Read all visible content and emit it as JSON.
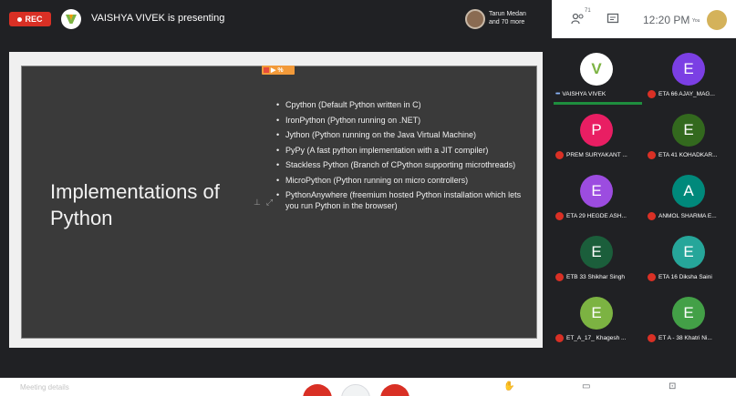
{
  "topbar": {
    "rec_label": "REC",
    "presenter_initial": "V",
    "presenting_text": "VAISHYA VIVEK is presenting",
    "participants_name": "Tarun Medan",
    "participants_more": "and 70 more"
  },
  "header": {
    "people_count": "71",
    "time": "12:20 PM",
    "me_label": "You"
  },
  "slide": {
    "badge": "▶ %",
    "title": "Implementations of Python",
    "bullets": [
      "Cpython (Default Python written in C)",
      "IronPython (Python running on .NET)",
      "Jython (Python running on the Java Virtual Machine)",
      "PyPy (A fast python implementation with a JIT compiler)",
      "Stackless Python (Branch of CPython supporting microthreads)",
      "MicroPython (Python running on micro controllers)",
      "PythonAnywhere (freemium hosted Python installation which lets you run Python in the browser)"
    ]
  },
  "participants": [
    {
      "initial": "V",
      "name": "VAISHYA VIVEK",
      "color": "#ffffff",
      "muted": false,
      "speaking": true
    },
    {
      "initial": "E",
      "name": "ETA 66 AJAY_MAG...",
      "color": "#7b3fe4",
      "muted": true,
      "speaking": false
    },
    {
      "initial": "P",
      "name": "PREM SURYAKANT ...",
      "color": "#e91e63",
      "muted": true,
      "speaking": false
    },
    {
      "initial": "E",
      "name": "ETA 41 KOHADKAR...",
      "color": "#33691e",
      "muted": true,
      "speaking": false
    },
    {
      "initial": "E",
      "name": "ETA 29 HEGDE ASH...",
      "color": "#9c4ce0",
      "muted": true,
      "speaking": false
    },
    {
      "initial": "A",
      "name": "ANMOL SHARMA E...",
      "color": "#00897b",
      "muted": true,
      "speaking": false
    },
    {
      "initial": "E",
      "name": "ETB 33 Shikhar Singh",
      "color": "#1b5e3b",
      "muted": true,
      "speaking": false
    },
    {
      "initial": "E",
      "name": "ETA 16 Diksha Saini",
      "color": "#26a69a",
      "muted": true,
      "speaking": false
    },
    {
      "initial": "E",
      "name": "ET_A_17_ Khagesh ...",
      "color": "#7cb342",
      "muted": true,
      "speaking": false
    },
    {
      "initial": "E",
      "name": "ET A - 38 Khatri Ni...",
      "color": "#43a047",
      "muted": true,
      "speaking": false
    }
  ],
  "controls": {
    "meeting_details": "Meeting details"
  },
  "colors": {
    "rec_red": "#d93025",
    "speaking_green": "#1e8e3e",
    "slide_bg": "#3a3a3a"
  }
}
